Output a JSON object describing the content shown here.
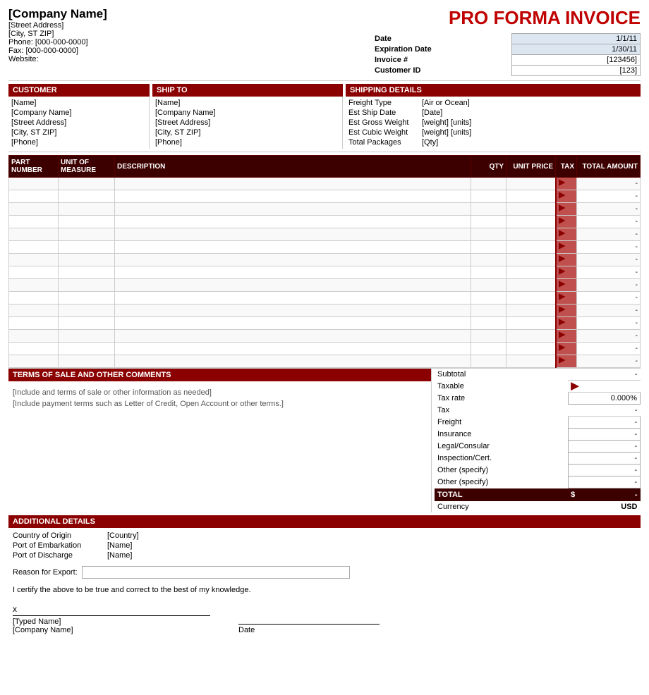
{
  "header": {
    "company_name": "[Company Name]",
    "street_address": "[Street Address]",
    "city_state_zip": "[City, ST  ZIP]",
    "phone": "Phone: [000-000-0000]",
    "fax": "Fax: [000-000-0000]",
    "website": "Website:",
    "title": "PRO FORMA INVOICE",
    "date_label": "Date",
    "date_value": "1/1/11",
    "expiration_label": "Expiration Date",
    "expiration_value": "1/30/11",
    "invoice_label": "Invoice #",
    "invoice_value": "[123456]",
    "customer_id_label": "Customer ID",
    "customer_id_value": "[123]"
  },
  "customer": {
    "section_label": "CUSTOMER",
    "name": "[Name]",
    "company": "[Company Name]",
    "address": "[Street Address]",
    "city": "[City, ST  ZIP]",
    "phone": "[Phone]"
  },
  "ship_to": {
    "section_label": "SHIP TO",
    "name": "[Name]",
    "company": "[Company Name]",
    "address": "[Street Address]",
    "city": "[City, ST  ZIP]",
    "phone": "[Phone]"
  },
  "shipping_details": {
    "section_label": "SHIPPING DETAILS",
    "freight_type_label": "Freight Type",
    "freight_type_value": "[Air or Ocean]",
    "est_ship_label": "Est Ship Date",
    "est_ship_value": "[Date]",
    "gross_weight_label": "Est Gross Weight",
    "gross_weight_value": "[weight] [units]",
    "cubic_weight_label": "Est Cubic Weight",
    "cubic_weight_value": "[weight] [units]",
    "total_packages_label": "Total Packages",
    "total_packages_value": "[Qty]"
  },
  "items_table": {
    "headers": {
      "part_number": "PART NUMBER",
      "unit_of_measure": "UNIT OF MEASURE",
      "description": "DESCRIPTION",
      "qty": "QTY",
      "unit_price": "UNIT PRICE",
      "tax": "TAX",
      "total_amount": "TOTAL AMOUNT"
    },
    "rows": 15
  },
  "terms": {
    "section_label": "TERMS OF SALE AND OTHER COMMENTS",
    "line1": "[Include and terms of sale or other information as needed]",
    "line2": "[Include payment terms such as Letter of Credit, Open Account or other terms.]"
  },
  "totals": {
    "subtotal_label": "Subtotal",
    "subtotal_value": "-",
    "taxable_label": "Taxable",
    "taxable_value": "",
    "tax_rate_label": "Tax rate",
    "tax_rate_value": "0.000%",
    "tax_label": "Tax",
    "tax_value": "-",
    "freight_label": "Freight",
    "freight_value": "-",
    "insurance_label": "Insurance",
    "insurance_value": "-",
    "legal_label": "Legal/Consular",
    "legal_value": "-",
    "inspection_label": "Inspection/Cert.",
    "inspection_value": "-",
    "other1_label": "Other (specify)",
    "other1_value": "-",
    "other2_label": "Other (specify)",
    "other2_value": "-",
    "total_label": "TOTAL",
    "total_dollar": "$",
    "total_value": "-",
    "currency_label": "Currency",
    "currency_value": "USD"
  },
  "additional": {
    "section_label": "ADDITIONAL DETAILS",
    "country_label": "Country of Origin",
    "country_value": "[Country]",
    "port_embark_label": "Port of Embarkation",
    "port_embark_value": "[Name]",
    "port_discharge_label": "Port of Discharge",
    "port_discharge_value": "[Name]",
    "reason_label": "Reason for Export:",
    "certify_text": "I certify the above to be true and correct to the best of my knowledge.",
    "x_label": "x",
    "typed_name": "[Typed Name]",
    "company_name_sig": "[Company Name]",
    "date_label": "Date"
  }
}
